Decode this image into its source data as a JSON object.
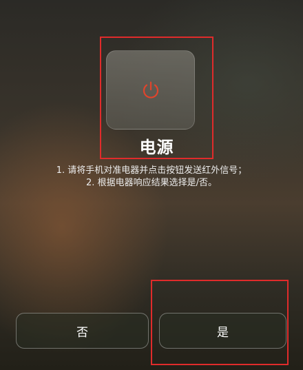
{
  "power": {
    "label": "电源",
    "icon": "power-icon",
    "icon_color": "#e0442c"
  },
  "instructions": {
    "line1": "1. 请将手机对准电器并点击按钮发送红外信号；",
    "line2": "2. 根据电器响应结果选择是/否。"
  },
  "buttons": {
    "no_label": "否",
    "yes_label": "是"
  },
  "colors": {
    "annotation": "#e12b2b"
  }
}
